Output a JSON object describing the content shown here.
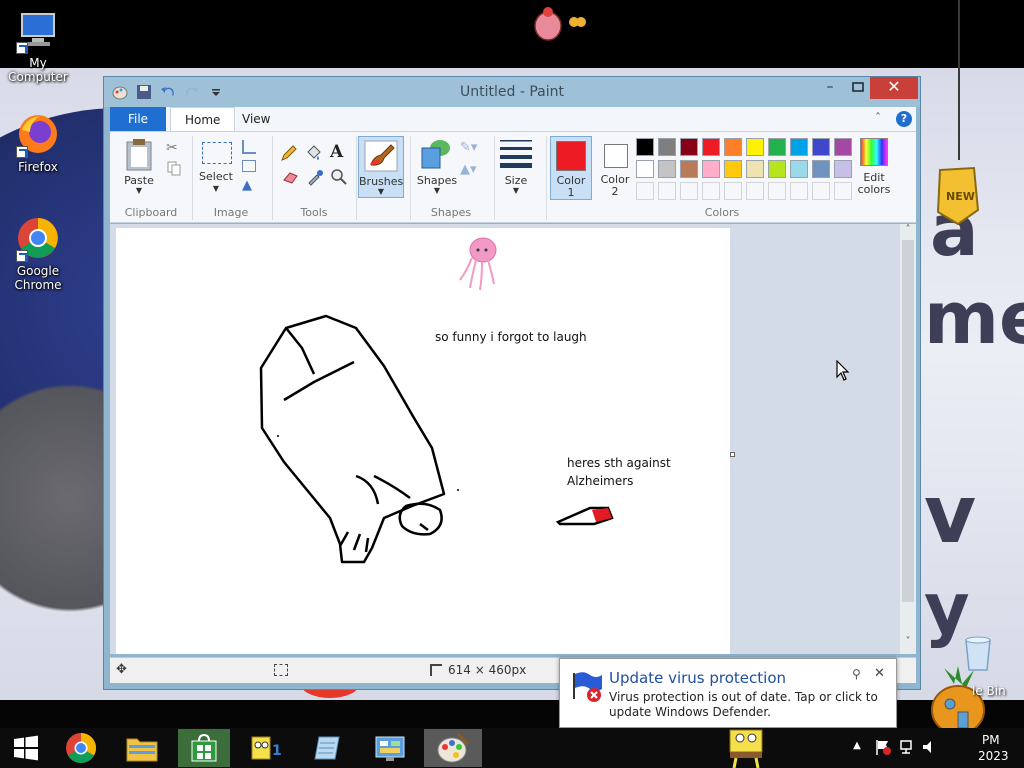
{
  "desktop": {
    "icons": [
      {
        "label": "My Computer"
      },
      {
        "label": "Firefox"
      },
      {
        "label": "Google Chrome"
      },
      {
        "label": "Recycle Bin"
      }
    ],
    "wallpaper_text": [
      "a",
      "me",
      "v",
      "y"
    ]
  },
  "paint": {
    "title": "Untitled - Paint",
    "tabs": {
      "file": "File",
      "home": "Home",
      "view": "View"
    },
    "groups": {
      "clipboard": "Clipboard",
      "image": "Image",
      "tools": "Tools",
      "shapes": "Shapes",
      "colors": "Colors"
    },
    "buttons": {
      "paste": "Paste",
      "select": "Select",
      "brushes": "Brushes",
      "shapes": "Shapes",
      "size": "Size",
      "color1": "Color 1",
      "color2": "Color 2",
      "edit_colors": "Edit colors"
    },
    "palette_row1": [
      "#000000",
      "#7f7f7f",
      "#880015",
      "#ed1c24",
      "#ff7f27",
      "#fff200",
      "#22b14c",
      "#00a2e8",
      "#3f48cc",
      "#a349a4"
    ],
    "palette_row2": [
      "#ffffff",
      "#c3c3c3",
      "#b97a57",
      "#ffaec9",
      "#ffc90e",
      "#efe4b0",
      "#b5e61d",
      "#99d9ea",
      "#7092be",
      "#c8bfe7"
    ],
    "color1_value": "#ed1c24",
    "color2_value": "#ffffff",
    "canvas_texts": {
      "caption1": "so funny i forgot to laugh",
      "caption2_line1": "heres sth against",
      "caption2_line2": "Alzheimers"
    },
    "status": {
      "canvas_size": "614 × 460px"
    }
  },
  "notification": {
    "title": "Update virus protection",
    "body": "Virus protection is out of date. Tap or click to update Windows Defender."
  },
  "taskbar": {
    "items": [
      "start",
      "chrome",
      "file-explorer",
      "store",
      "spongebob-game",
      "notepad",
      "control-panel",
      "paint"
    ],
    "clock": {
      "time_fragment": "PM",
      "date_fragment": "2023"
    },
    "tray_label": "le Bin"
  }
}
